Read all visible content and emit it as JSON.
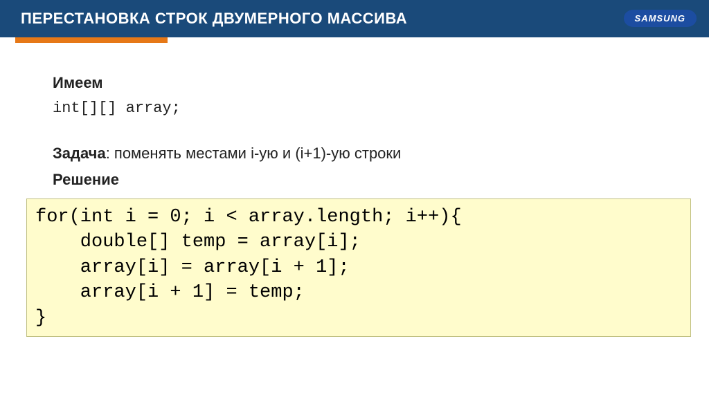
{
  "header": {
    "title": "ПЕРЕСТАНОВКА СТРОК ДВУМЕРНОГО МАССИВА",
    "logo": "SAMSUNG"
  },
  "content": {
    "have_label": "Имеем",
    "declaration": "int[][] array;",
    "task_label": "Задача",
    "task_text": ": поменять местами i-ую и (i+1)-ую строки",
    "solution_label": "Решение"
  },
  "code": "for(int i = 0; i < array.length; i++){\n    double[] temp = array[i];\n    array[i] = array[i + 1];\n    array[i + 1] = temp;\n}"
}
